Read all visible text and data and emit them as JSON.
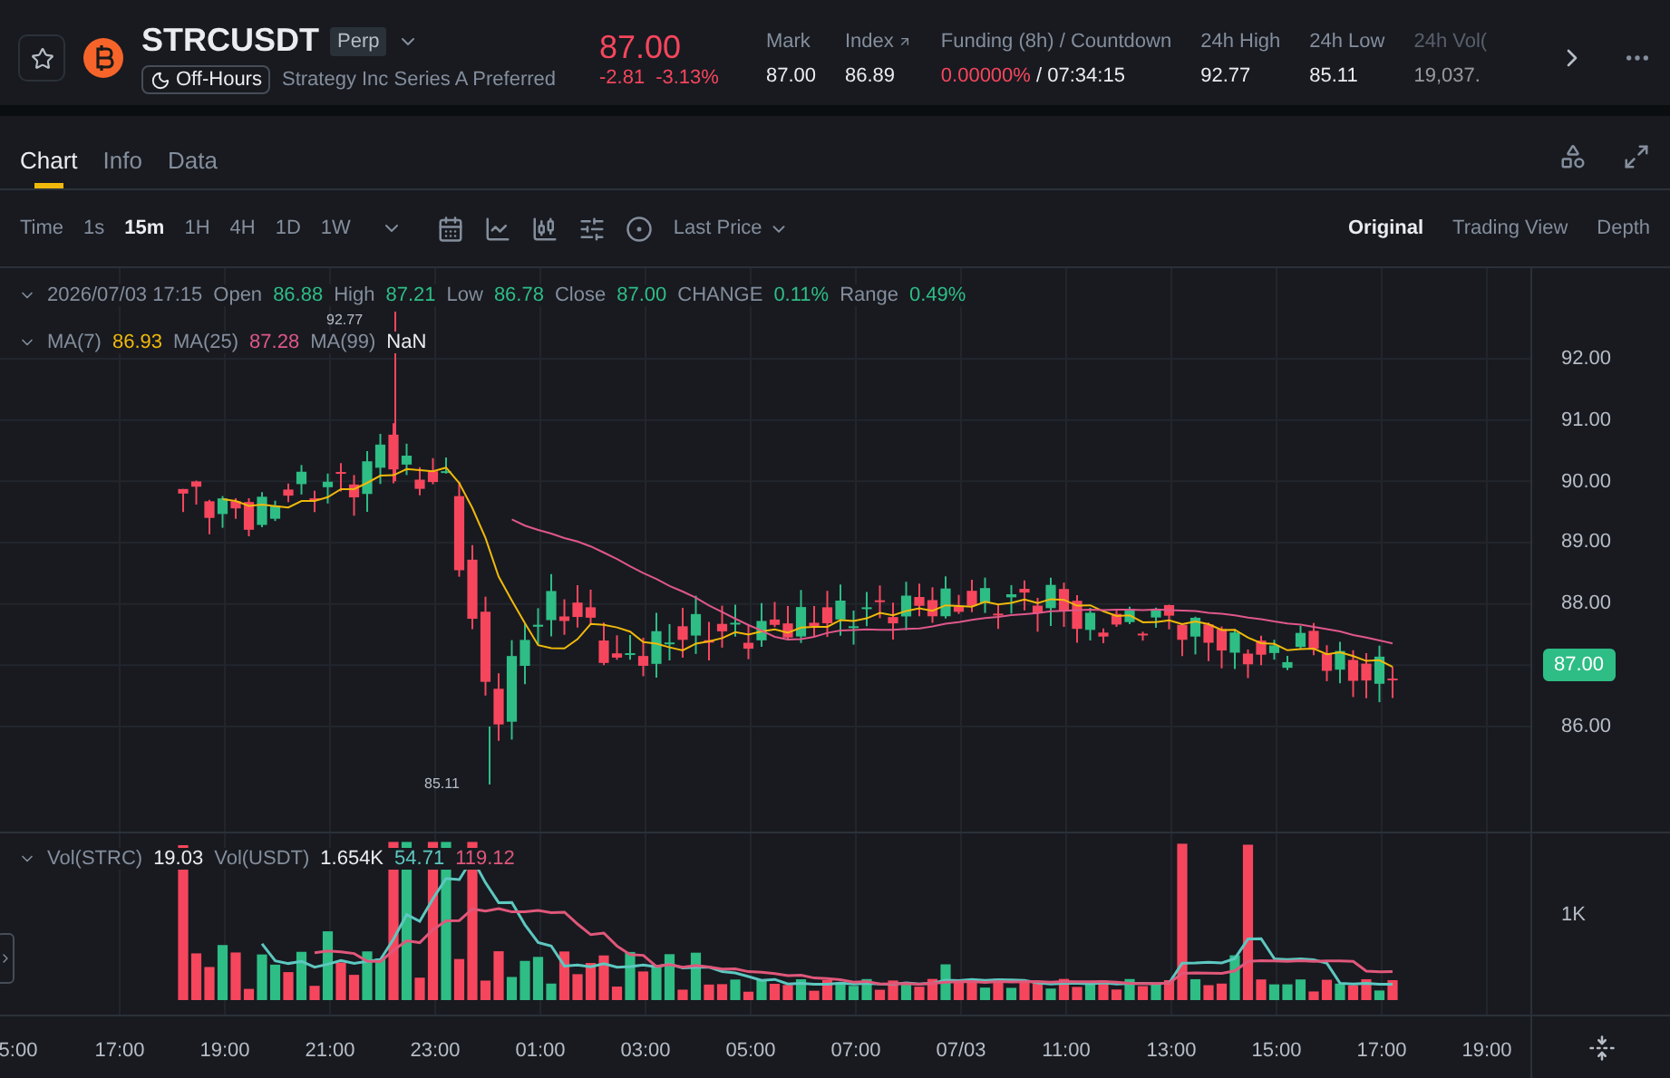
{
  "header": {
    "symbol": "STRCUSDT",
    "market_type": "Perp",
    "status": "Off-Hours",
    "name": "Strategy Inc Series A Preferred",
    "last_price": "87.00",
    "change": "-2.81",
    "change_pct": "-3.13%",
    "stats": [
      {
        "label": "Mark",
        "value": "87.00"
      },
      {
        "label": "Index",
        "value": "86.89",
        "linked": true
      },
      {
        "label": "Funding (8h) / Countdown",
        "value": "0.00000%",
        "value_2": "/ 07:34:15",
        "kind": "funding"
      },
      {
        "label": "24h High",
        "value": "92.77"
      },
      {
        "label": "24h Low",
        "value": "85.11"
      },
      {
        "label": "24h Vol(",
        "value": "19,037.",
        "kind": "faded"
      }
    ]
  },
  "tabs": [
    {
      "label": "Chart",
      "selected": true
    },
    {
      "label": "Info",
      "selected": false
    },
    {
      "label": "Data",
      "selected": false
    }
  ],
  "toolbar": {
    "time_label": "Time",
    "intervals": [
      {
        "label": "1s",
        "selected": false
      },
      {
        "label": "15m",
        "selected": true
      },
      {
        "label": "1H",
        "selected": false
      },
      {
        "label": "4H",
        "selected": false
      },
      {
        "label": "1D",
        "selected": false
      },
      {
        "label": "1W",
        "selected": false
      }
    ],
    "price_source": "Last Price",
    "views": [
      {
        "label": "Original",
        "selected": true
      },
      {
        "label": "Trading View",
        "selected": false
      },
      {
        "label": "Depth",
        "selected": false
      }
    ]
  },
  "legend": {
    "datetime": "2026/07/03 17:15",
    "fields": [
      {
        "label": "Open",
        "value": "86.88"
      },
      {
        "label": "High",
        "value": "87.21"
      },
      {
        "label": "Low",
        "value": "86.78"
      },
      {
        "label": "Close",
        "value": "87.00"
      },
      {
        "label": "CHANGE",
        "value": "0.11%"
      },
      {
        "label": "Range",
        "value": "0.49%"
      }
    ],
    "ma": [
      {
        "label": "MA(7)",
        "value": "86.93",
        "color": "#f0b90b"
      },
      {
        "label": "MA(25)",
        "value": "87.28",
        "color": "#e0578a"
      },
      {
        "label": "MA(99)",
        "value": "NaN",
        "color": "#eaecef"
      }
    ]
  },
  "price_axis": [
    "92.00",
    "91.00",
    "90.00",
    "89.00",
    "88.00",
    "86.00"
  ],
  "current_price": "87.00",
  "high_marker": "92.77",
  "low_marker": "85.11",
  "volume": {
    "fields": [
      {
        "label": "Vol(STRC)",
        "value": "19.03",
        "color": "#eaecef"
      },
      {
        "label": "Vol(USDT)",
        "value": "1.654K",
        "color": "#eaecef"
      },
      {
        "value": "54.71",
        "color": "#5dc8c0"
      },
      {
        "value": "119.12",
        "color": "#e0577a"
      }
    ],
    "axis": "1K"
  },
  "time_axis": [
    "5:00",
    "17:00",
    "19:00",
    "21:00",
    "23:00",
    "01:00",
    "03:00",
    "05:00",
    "07:00",
    "07/03",
    "11:00",
    "13:00",
    "15:00",
    "17:00",
    "19:00"
  ]
}
